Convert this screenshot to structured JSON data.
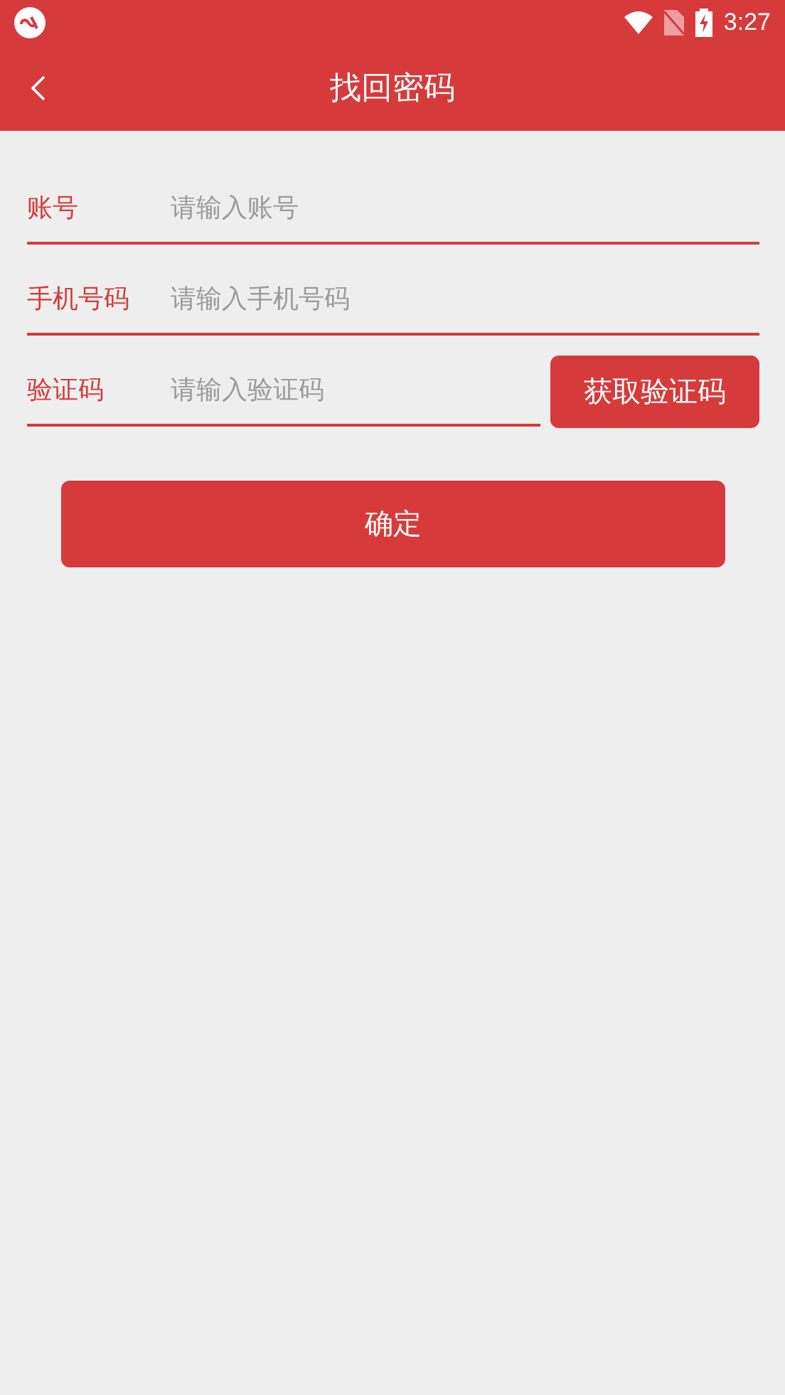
{
  "status_bar": {
    "time": "3:27"
  },
  "header": {
    "title": "找回密码"
  },
  "fields": [
    {
      "label": "账号",
      "placeholder": "请输入账号",
      "kind": "text"
    },
    {
      "label": "手机号码",
      "placeholder": "请输入手机号码",
      "kind": "text"
    },
    {
      "label": "验证码",
      "placeholder": "请输入验证码",
      "kind": "code",
      "button": "获取验证码"
    }
  ],
  "submit": "确定"
}
